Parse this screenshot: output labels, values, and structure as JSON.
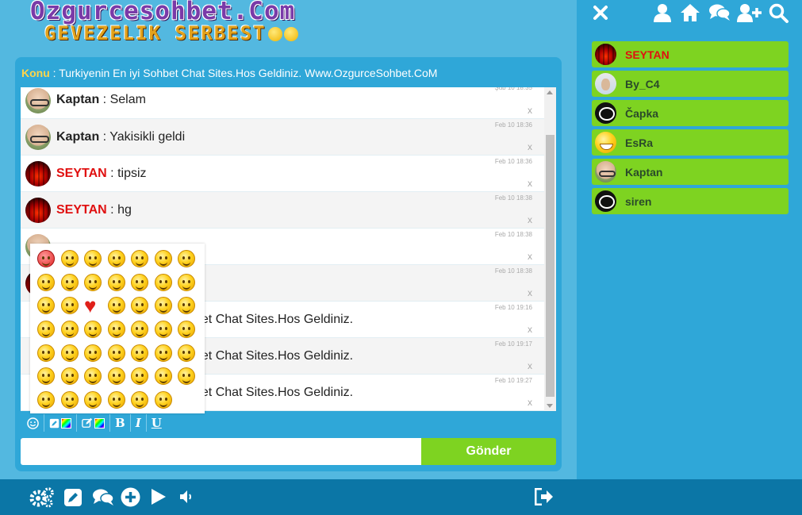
{
  "logo": {
    "line1": "Ozgurcesohbet.Com",
    "line2": "GEVEZELIK SERBEST"
  },
  "topic": {
    "label": "Konu",
    "separator": " : ",
    "text": "Turkiyenin En iyi Sohbet Chat Sites.Hos Geldiniz. Www.OzgurceSohbet.CoM"
  },
  "messages": [
    {
      "user": "Kaptan",
      "text": "Selam",
      "time": "Şub 10 18:35",
      "avatar": "kaptan",
      "color": "#222222"
    },
    {
      "user": "Kaptan",
      "text": "Yakisikli geldi",
      "time": "Feb 10 18:36",
      "avatar": "kaptan",
      "color": "#222222"
    },
    {
      "user": "SEYTAN",
      "text": "tipsiz",
      "time": "Feb 10 18:36",
      "avatar": "seytan",
      "color": "#e01010"
    },
    {
      "user": "SEYTAN",
      "text": "hg",
      "time": "Feb 10 18:38",
      "avatar": "seytan",
      "color": "#e01010"
    },
    {
      "user": "",
      "text": "",
      "time": "Feb 10 18:38",
      "avatar": "kaptan",
      "color": "#222222"
    },
    {
      "user": "",
      "text": "",
      "time": "Feb 10 18:38",
      "avatar": "seytan",
      "color": "#e01010"
    },
    {
      "user": "",
      "text": "bet Chat Sites.Hos Geldiniz.",
      "time": "Feb 10 19:16",
      "avatar": "",
      "color": "#222222"
    },
    {
      "user": "",
      "text": "bet Chat Sites.Hos Geldiniz.",
      "time": "Feb 10 19:17",
      "avatar": "",
      "color": "#222222"
    },
    {
      "user": "",
      "text": "bet Chat Sites.Hos Geldiniz.",
      "time": "Feb 10 19:27",
      "avatar": "",
      "color": "#222222"
    }
  ],
  "message_delete_label": "x",
  "toolbar": {
    "bold": "B",
    "italic": "I",
    "underline": "U"
  },
  "composer": {
    "input_value": "",
    "send_label": "Gönder"
  },
  "users": [
    {
      "name": "SEYTAN",
      "avatar": "seytan",
      "highlight": true
    },
    {
      "name": "By_C4",
      "avatar": "byc4",
      "highlight": false
    },
    {
      "name": "Čapka",
      "avatar": "dark",
      "highlight": false
    },
    {
      "name": "EsRa",
      "avatar": "esra",
      "highlight": false
    },
    {
      "name": "Kaptan",
      "avatar": "kaptan",
      "highlight": false
    },
    {
      "name": "siren",
      "avatar": "dark",
      "highlight": false
    }
  ],
  "top_icons": [
    "close-icon",
    "user-icon",
    "home-icon",
    "comments-icon",
    "add-user-icon",
    "search-icon"
  ],
  "bottom_icons": [
    "settings-icon",
    "edit-icon",
    "comments-icon",
    "plus-circle-icon",
    "play-icon",
    "volume-icon",
    "logout-icon"
  ],
  "colors": {
    "background": "#53b8e0",
    "panel": "#2fa7d8",
    "accent_green": "#7ed321",
    "bottom_bar": "#0b76a6",
    "topic_label": "#ffd54a",
    "red_user": "#e01010"
  },
  "emoji_grid_count": 48
}
